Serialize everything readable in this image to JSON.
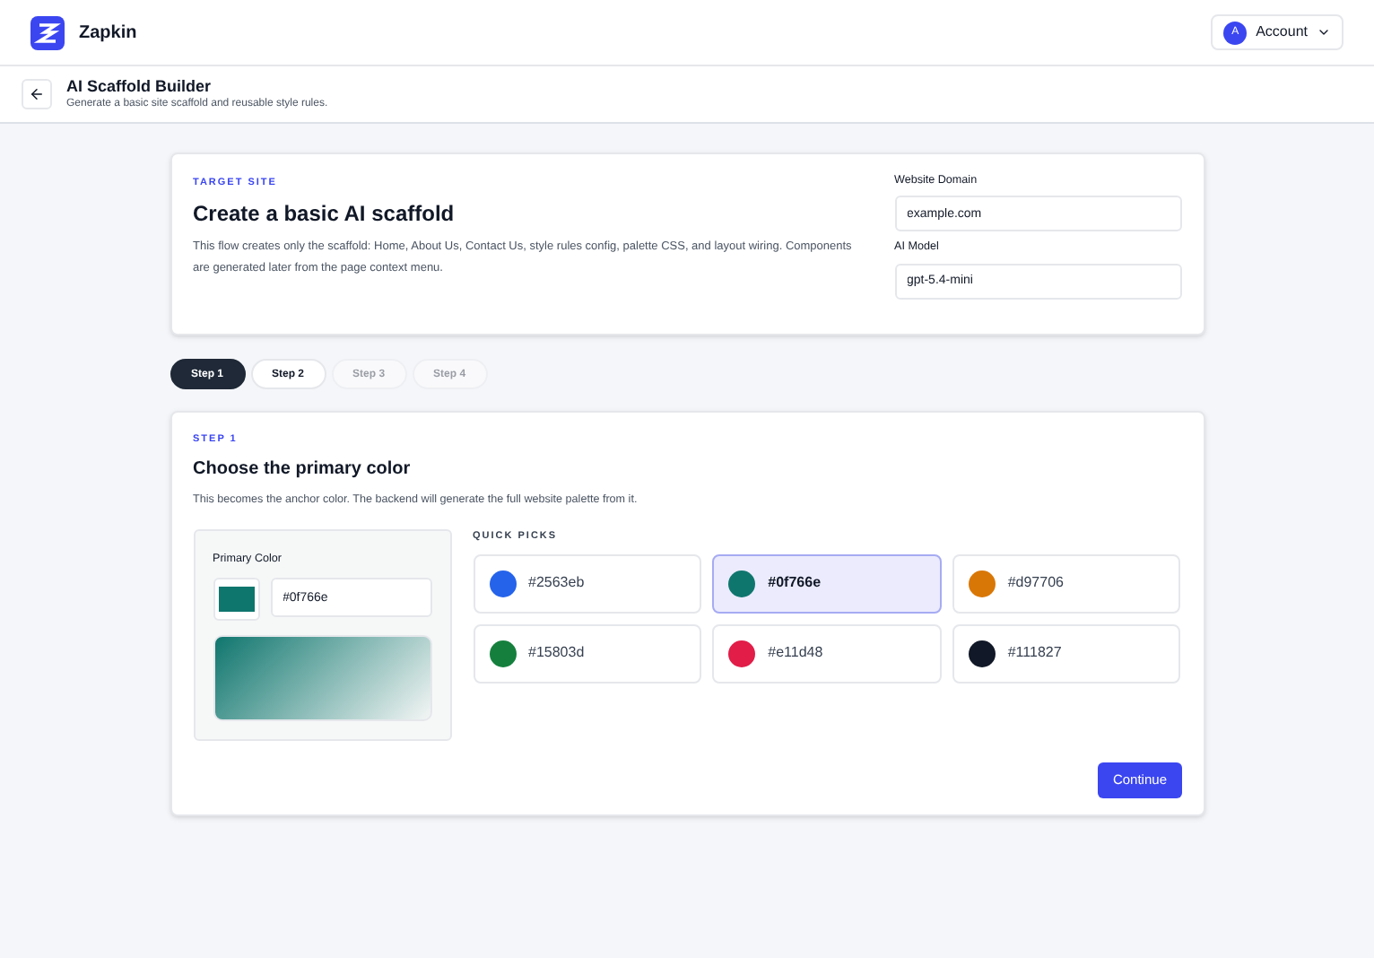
{
  "header": {
    "brand": "Zapkin",
    "account": {
      "initial": "A",
      "label": "Account"
    }
  },
  "page": {
    "title": "AI Scaffold Builder",
    "subtitle": "Generate a basic site scaffold and reusable style rules."
  },
  "target": {
    "eyebrow": "TARGET SITE",
    "title": "Create a basic AI scaffold",
    "description": "This flow creates only the scaffold: Home, About Us, Contact Us, style rules config, palette CSS, and layout wiring. Components are generated later from the page context menu.",
    "fields": [
      {
        "label": "Website Domain",
        "value": "example.com"
      },
      {
        "label": "AI Model",
        "value": "gpt-5.4-mini"
      }
    ]
  },
  "steps": [
    {
      "label": "Step 1",
      "selected": true,
      "disabled": false
    },
    {
      "label": "Step 2",
      "selected": false,
      "disabled": false
    },
    {
      "label": "Step 3",
      "selected": false,
      "disabled": true
    },
    {
      "label": "Step 4",
      "selected": false,
      "disabled": true
    }
  ],
  "step_card": {
    "eyebrow": "STEP 1",
    "title": "Choose the primary color",
    "description": "This becomes the anchor color. The backend will generate the full website palette from it.",
    "primary": {
      "label": "Primary Color",
      "value": "#0f766e",
      "color": "#0f766e"
    },
    "quick_picks_label": "QUICK PICKS",
    "quick_picks": [
      {
        "label": "#2563eb",
        "color": "#2563eb",
        "selected": false
      },
      {
        "label": "#0f766e",
        "color": "#0f766e",
        "selected": true
      },
      {
        "label": "#d97706",
        "color": "#d97706",
        "selected": false
      },
      {
        "label": "#15803d",
        "color": "#15803d",
        "selected": false
      },
      {
        "label": "#e11d48",
        "color": "#e11d48",
        "selected": false
      },
      {
        "label": "#111827",
        "color": "#111827",
        "selected": false
      }
    ],
    "continue": "Continue"
  }
}
